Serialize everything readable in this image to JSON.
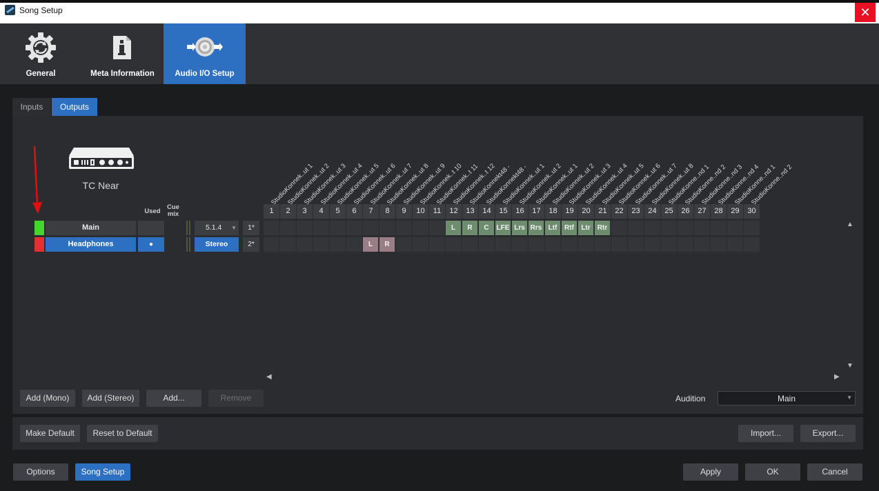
{
  "window": {
    "title": "Song Setup",
    "close_symbol": "✕"
  },
  "header_tabs": [
    {
      "label": "General",
      "icon": "gear-icon"
    },
    {
      "label": "Meta Information",
      "icon": "info-icon"
    },
    {
      "label": "Audio I/O Setup",
      "icon": "audio-io-icon"
    }
  ],
  "subtabs": {
    "inputs": "Inputs",
    "outputs": "Outputs",
    "active": "Outputs"
  },
  "device": {
    "name": "TC Near",
    "icon": "audio-interface-icon"
  },
  "columns": {
    "used": "Used",
    "cue_mix": "Cue mix"
  },
  "channel_labels": [
    "StudioKonnek..ut 1",
    "StudioKonnek..ut 2",
    "StudioKonnek..ut 3",
    "StudioKonnek..ut 4",
    "StudioKonnek..ut 5",
    "StudioKonnek..ut 6",
    "StudioKonnek..ut 7",
    "StudioKonnek..ut 8",
    "StudioKonnek..ut 9",
    "StudioKonnek..t 10",
    "StudioKonnek..t 11",
    "StudioKonnek..t 12",
    "StudioKonnekt48 -",
    "StudioKonnekt48 -",
    "StudioKonnek..ut 1",
    "StudioKonnek..ut 2",
    "StudioKonnek..ut 1",
    "StudioKonnek..ut 2",
    "StudioKonnek..ut 3",
    "StudioKonnek..ut 4",
    "StudioKonnek..ut 5",
    "StudioKonnek..ut 6",
    "StudioKonnek..ut 7",
    "StudioKonnek..ut 8",
    "StudioKonne..nd 1",
    "StudioKonne..nd 2",
    "StudioKonne..nd 3",
    "StudioKonne..nd 4",
    "StudioKonne..nd 1",
    "StudioKonne..nd 2"
  ],
  "channel_numbers": [
    "1",
    "2",
    "3",
    "4",
    "5",
    "6",
    "7",
    "8",
    "9",
    "10",
    "11",
    "12",
    "13",
    "14",
    "15",
    "16",
    "17",
    "18",
    "19",
    "20",
    "21",
    "22",
    "23",
    "24",
    "25",
    "26",
    "27",
    "28",
    "29",
    "30"
  ],
  "outputs": [
    {
      "name": "Main",
      "color": "#44d62c",
      "used": "",
      "format": "5.1.4",
      "index": "1*",
      "assignments": [
        {
          "col": 12,
          "label": "L"
        },
        {
          "col": 13,
          "label": "R"
        },
        {
          "col": 14,
          "label": "C"
        },
        {
          "col": 15,
          "label": "LFE"
        },
        {
          "col": 16,
          "label": "Lrs"
        },
        {
          "col": 17,
          "label": "Rrs"
        },
        {
          "col": 18,
          "label": "Ltf"
        },
        {
          "col": 19,
          "label": "Rtf"
        },
        {
          "col": 20,
          "label": "Ltr"
        },
        {
          "col": 21,
          "label": "Rtr"
        }
      ]
    },
    {
      "name": "Headphones",
      "color": "#e53030",
      "used": "●",
      "format": "Stereo",
      "index": "2*",
      "assignments": [
        {
          "col": 7,
          "label": "L"
        },
        {
          "col": 8,
          "label": "R"
        }
      ]
    }
  ],
  "buttons": {
    "add_mono": "Add (Mono)",
    "add_stereo": "Add (Stereo)",
    "add": "Add...",
    "remove": "Remove",
    "make_default": "Make Default",
    "reset_default": "Reset to Default",
    "import": "Import...",
    "export": "Export...",
    "options": "Options",
    "song_setup": "Song Setup",
    "apply": "Apply",
    "ok": "OK",
    "cancel": "Cancel"
  },
  "audition": {
    "label": "Audition",
    "value": "Main"
  },
  "colors": {
    "accent": "#2d6fc0",
    "annotation_arrow": "#e01010"
  }
}
